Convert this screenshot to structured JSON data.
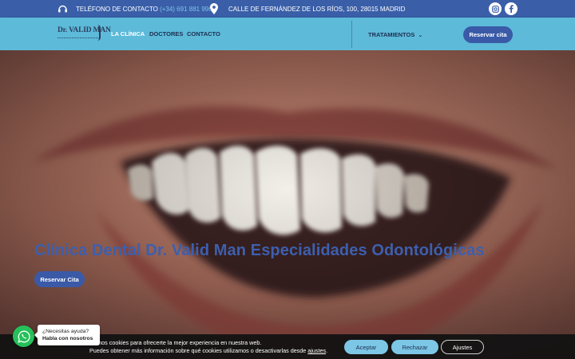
{
  "topbar": {
    "phone_label": "TELÉFONO DE CONTACTO",
    "phone_number": "(+34) 691 881 996",
    "address": "CALLE DE FERNÁNDEZ DE LOS RÍOS, 100, 28015 MADRID",
    "icons": [
      "headset-icon",
      "location-pin-icon",
      "instagram-icon",
      "facebook-icon"
    ]
  },
  "nav": {
    "logo_text": "Dr. VALID MAN",
    "items": [
      {
        "label": "LA CLÍNICA"
      },
      {
        "label": "DOCTORES"
      },
      {
        "label": "CONTACTO"
      }
    ],
    "dropdown_label": "TRATAMIENTOS",
    "cta_label": "Reservar cita"
  },
  "hero": {
    "title": "Clínica Dental Dr. Valid Man Especialidades Odontológicas",
    "button_label": "Reservar Cita"
  },
  "cookie": {
    "line1": "izamos cookies para ofrecerte la mejor experiencia en nuestra web.",
    "line2_prefix": "Puedes obtener  más información sobre qué  cookies utilizamos o desactivarlas desde ",
    "line2_link": "ajustes",
    "line2_suffix": ".",
    "accept_label": "Aceptar",
    "reject_label": "Rechazar",
    "settings_label": "Ajustes"
  },
  "whatsapp": {
    "line1": "¿Necesitas ayuda?",
    "line2": "Habla con nosotros"
  },
  "colors": {
    "topbar_bg": "#3a5fa8",
    "nav_bg": "#5dbad9",
    "accent": "#3a5aa8",
    "phone_link": "#7ec3e8",
    "whatsapp": "#25c05a"
  }
}
